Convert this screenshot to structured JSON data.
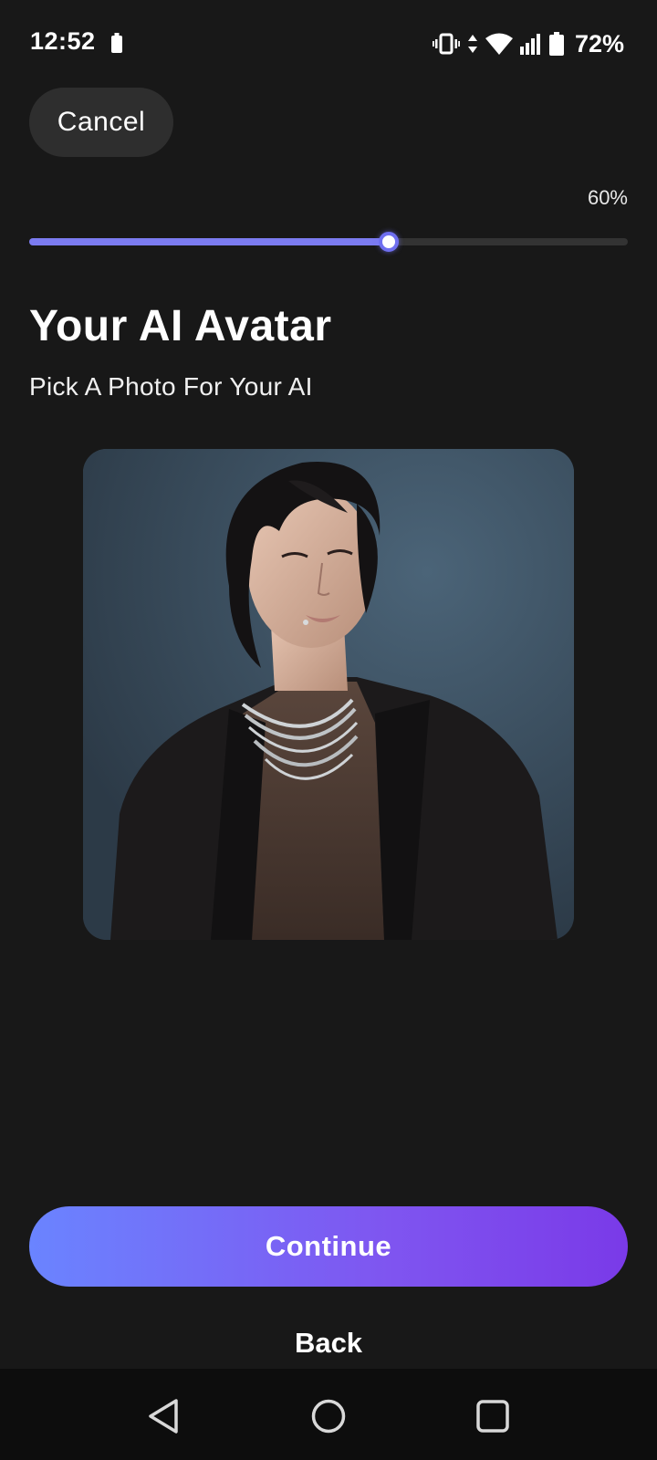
{
  "status_bar": {
    "time": "12:52",
    "battery_percent": "72%",
    "icons": [
      "battery-icon",
      "vibrate-icon",
      "data-arrows-icon",
      "wifi-icon",
      "signal-icon",
      "battery-icon"
    ]
  },
  "header": {
    "cancel_label": "Cancel"
  },
  "progress": {
    "label": "60%",
    "value": 0.6,
    "fill_color": "#7b7bf0"
  },
  "main": {
    "title": "Your AI Avatar",
    "subtitle": "Pick A Photo For Your AI",
    "photo": {
      "description": "avatar-photo"
    }
  },
  "footer": {
    "continue_label": "Continue",
    "back_label": "Back",
    "continue_gradient": [
      "#6a84ff",
      "#7a3ae8"
    ]
  },
  "nav_bar": {
    "icons": [
      "back-triangle-icon",
      "home-circle-icon",
      "recents-square-icon"
    ]
  }
}
